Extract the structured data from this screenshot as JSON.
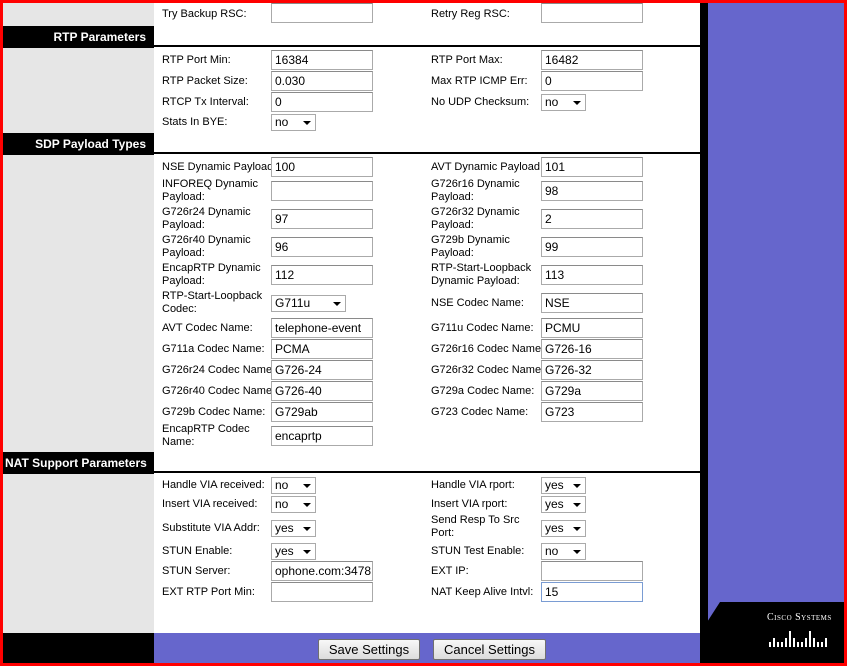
{
  "sections": {
    "rtp": "RTP Parameters",
    "sdp": "SDP Payload Types",
    "nat": "NAT Support Parameters"
  },
  "fields": {
    "try_backup_rsc": {
      "label": "Try Backup RSC:",
      "value": ""
    },
    "retry_reg_rsc": {
      "label": "Retry Reg RSC:",
      "value": ""
    },
    "rtp_port_min": {
      "label": "RTP Port Min:",
      "value": "16384"
    },
    "rtp_port_max": {
      "label": "RTP Port Max:",
      "value": "16482"
    },
    "rtp_packet_size": {
      "label": "RTP Packet Size:",
      "value": "0.030"
    },
    "max_rtp_icmp_err": {
      "label": "Max RTP ICMP Err:",
      "value": "0"
    },
    "rtcp_tx_interval": {
      "label": "RTCP Tx Interval:",
      "value": "0"
    },
    "no_udp_checksum": {
      "label": "No UDP Checksum:",
      "value": "no"
    },
    "stats_in_bye": {
      "label": "Stats In BYE:",
      "value": "no"
    },
    "nse_dynamic_payload": {
      "label": "NSE Dynamic Payload:",
      "value": "100"
    },
    "avt_dynamic_payload": {
      "label": "AVT Dynamic Payload:",
      "value": "101"
    },
    "inforeq_dynamic_payload": {
      "label1": "INFOREQ Dynamic",
      "label2": "Payload:",
      "value": ""
    },
    "g726r16_dynamic_payload": {
      "label1": "G726r16 Dynamic",
      "label2": "Payload:",
      "value": "98"
    },
    "g726r24_dynamic_payload": {
      "label1": "G726r24 Dynamic",
      "label2": "Payload:",
      "value": "97"
    },
    "g726r32_dynamic_payload": {
      "label1": "G726r32 Dynamic",
      "label2": "Payload:",
      "value": "2"
    },
    "g726r40_dynamic_payload": {
      "label1": "G726r40 Dynamic",
      "label2": "Payload:",
      "value": "96"
    },
    "g729b_dynamic_payload": {
      "label1": "G729b Dynamic",
      "label2": "Payload:",
      "value": "99"
    },
    "encaprtp_dynamic_payload": {
      "label1": "EncapRTP Dynamic",
      "label2": "Payload:",
      "value": "112"
    },
    "rtp_start_loopback_dynamic_payload": {
      "label1": "RTP-Start-Loopback",
      "label2": "Dynamic Payload:",
      "value": "113"
    },
    "rtp_start_loopback_codec": {
      "label1": "RTP-Start-Loopback",
      "label2": "Codec:",
      "value": "G711u"
    },
    "nse_codec_name": {
      "label": "NSE Codec Name:",
      "value": "NSE"
    },
    "avt_codec_name": {
      "label": "AVT Codec Name:",
      "value": "telephone-event"
    },
    "g711u_codec_name": {
      "label": "G711u Codec Name:",
      "value": "PCMU"
    },
    "g711a_codec_name": {
      "label": "G711a Codec Name:",
      "value": "PCMA"
    },
    "g726r16_codec_name": {
      "label": "G726r16 Codec Name:",
      "value": "G726-16"
    },
    "g726r24_codec_name": {
      "label": "G726r24 Codec Name:",
      "value": "G726-24"
    },
    "g726r32_codec_name": {
      "label": "G726r32 Codec Name:",
      "value": "G726-32"
    },
    "g726r40_codec_name": {
      "label": "G726r40 Codec Name:",
      "value": "G726-40"
    },
    "g729a_codec_name": {
      "label": "G729a Codec Name:",
      "value": "G729a"
    },
    "g729b_codec_name": {
      "label": "G729b Codec Name:",
      "value": "G729ab"
    },
    "g723_codec_name": {
      "label": "G723 Codec Name:",
      "value": "G723"
    },
    "encaprtp_codec_name": {
      "label1": "EncapRTP Codec",
      "label2": "Name:",
      "value": "encaprtp"
    },
    "handle_via_received": {
      "label": "Handle VIA received:",
      "value": "no"
    },
    "handle_via_rport": {
      "label": "Handle VIA rport:",
      "value": "yes"
    },
    "insert_via_received": {
      "label": "Insert VIA received:",
      "value": "no"
    },
    "insert_via_rport": {
      "label": "Insert VIA rport:",
      "value": "yes"
    },
    "substitute_via_addr": {
      "label": "Substitute VIA Addr:",
      "value": "yes"
    },
    "send_resp_to_src_port": {
      "label1": "Send Resp To Src",
      "label2": "Port:",
      "value": "yes"
    },
    "stun_enable": {
      "label": "STUN Enable:",
      "value": "yes"
    },
    "stun_test_enable": {
      "label": "STUN Test Enable:",
      "value": "no"
    },
    "stun_server": {
      "label": "STUN Server:",
      "value": "ophone.com:3478"
    },
    "ext_ip": {
      "label": "EXT IP:",
      "value": ""
    },
    "ext_rtp_port_min": {
      "label": "EXT RTP Port Min:",
      "value": ""
    },
    "nat_keep_alive_intvl": {
      "label": "NAT Keep Alive Intvl:",
      "value": "15"
    }
  },
  "buttons": {
    "save": "Save Settings",
    "cancel": "Cancel Settings"
  },
  "logo": {
    "text": "Cisco Systems"
  }
}
